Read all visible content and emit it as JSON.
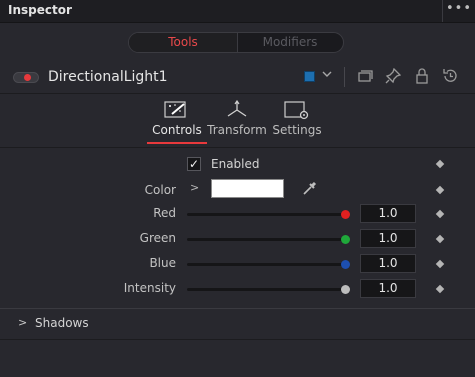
{
  "window": {
    "title": "Inspector",
    "more_label": "•••"
  },
  "mode_toggle": {
    "tools": "Tools",
    "modifiers": "Modifiers"
  },
  "node": {
    "name": "DirectionalLight1",
    "color": "#1d6fb0"
  },
  "tabs": [
    {
      "label": "Controls",
      "icon": "controls-icon",
      "active": true
    },
    {
      "label": "Transform",
      "icon": "transform-icon",
      "active": false
    },
    {
      "label": "Settings",
      "icon": "settings-icon",
      "active": false
    }
  ],
  "controls": {
    "enabled": {
      "label": "Enabled",
      "checked": true,
      "check_glyph": "✓"
    },
    "color": {
      "label": "Color",
      "value": "#ffffff",
      "expand_glyph": ">"
    },
    "red": {
      "label": "Red",
      "value": "1.0",
      "knob_color": "#e02020"
    },
    "green": {
      "label": "Green",
      "value": "1.0",
      "knob_color": "#1fa83a"
    },
    "blue": {
      "label": "Blue",
      "value": "1.0",
      "knob_color": "#1d4fb0"
    },
    "intensity": {
      "label": "Intensity",
      "value": "1.0",
      "knob_color": "#bdbdbd"
    }
  },
  "sections": {
    "shadows": {
      "label": "Shadows",
      "expand_glyph": ">"
    }
  }
}
